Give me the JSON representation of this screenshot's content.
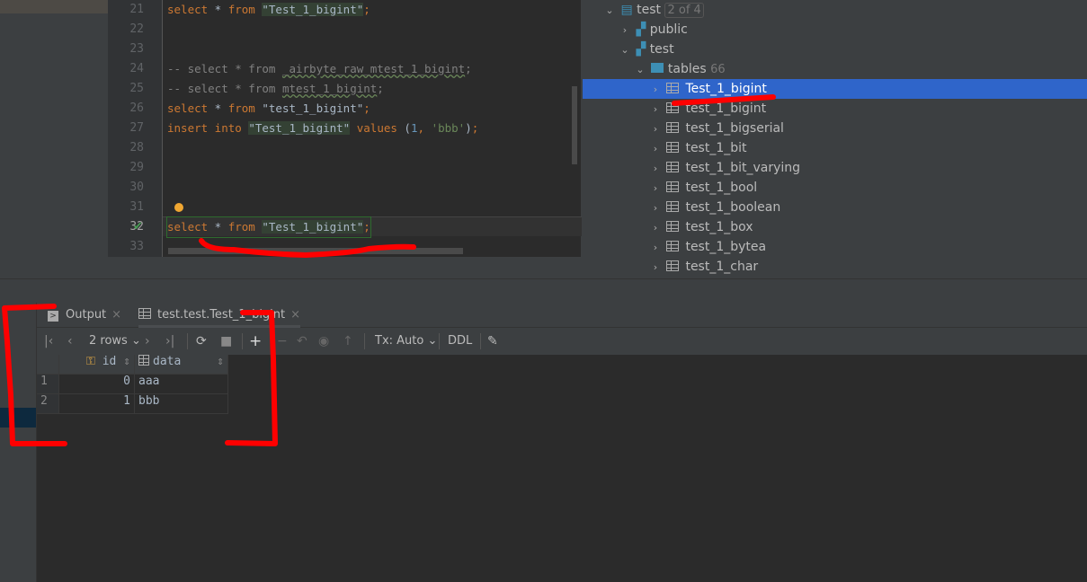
{
  "editor": {
    "lines": [
      {
        "n": "21",
        "tokens": [
          [
            "kw",
            "select"
          ],
          [
            "id",
            " * "
          ],
          [
            "kw",
            "from"
          ],
          [
            "id",
            " "
          ],
          [
            "id hl",
            "\"Test_1_bigint\""
          ],
          [
            "kw",
            ";"
          ]
        ]
      },
      {
        "n": "22",
        "tokens": []
      },
      {
        "n": "23",
        "tokens": []
      },
      {
        "n": "24",
        "tokens": [
          [
            "cm",
            "-- select * from "
          ],
          [
            "cm wavy",
            "_airbyte_raw_mtest_1_bigint"
          ],
          [
            "cm",
            ";"
          ]
        ]
      },
      {
        "n": "25",
        "tokens": [
          [
            "cm",
            "-- select * from "
          ],
          [
            "cm wavy",
            "mtest_1_bigint"
          ],
          [
            "cm",
            ";"
          ]
        ]
      },
      {
        "n": "26",
        "tokens": [
          [
            "kw",
            "select"
          ],
          [
            "id",
            " * "
          ],
          [
            "kw",
            "from"
          ],
          [
            "id",
            " \"test_1_bigint\""
          ],
          [
            "kw",
            ";"
          ]
        ]
      },
      {
        "n": "27",
        "tokens": [
          [
            "kw",
            "insert into"
          ],
          [
            "id",
            " "
          ],
          [
            "id hl",
            "\"Test_1_bigint\""
          ],
          [
            "id",
            " "
          ],
          [
            "kw",
            "values"
          ],
          [
            "id",
            " ("
          ],
          [
            "num",
            "1"
          ],
          [
            "kw",
            ", "
          ],
          [
            "str",
            "'bbb'"
          ],
          [
            "id",
            ")"
          ],
          [
            "kw",
            ";"
          ]
        ]
      },
      {
        "n": "28",
        "tokens": []
      },
      {
        "n": "29",
        "tokens": []
      },
      {
        "n": "30",
        "tokens": []
      },
      {
        "n": "31",
        "tokens": []
      },
      {
        "n": "32",
        "tokens": [
          [
            "kw",
            "select"
          ],
          [
            "id",
            " * "
          ],
          [
            "kw",
            "from"
          ],
          [
            "id",
            " "
          ],
          [
            "id hl",
            "\"Test_1_bigint\""
          ],
          [
            "kw",
            ";"
          ]
        ]
      },
      {
        "n": "33",
        "tokens": []
      }
    ]
  },
  "tree": {
    "root": {
      "label": "test",
      "badge": "2 of 4"
    },
    "schemas": [
      {
        "label": "public"
      },
      {
        "label": "test"
      }
    ],
    "folder": {
      "label": "tables",
      "count": "66"
    },
    "tables": [
      "Test_1_bigint",
      "test_1_bigint",
      "test_1_bigserial",
      "test_1_bit",
      "test_1_bit_varying",
      "test_1_bool",
      "test_1_boolean",
      "test_1_box",
      "test_1_bytea",
      "test_1_char"
    ]
  },
  "results": {
    "tabs": [
      {
        "label": "Output"
      },
      {
        "label": "test.test.Test_1_bigint"
      }
    ],
    "toolbar": {
      "rows": "2 rows",
      "tx": "Tx: Auto",
      "ddl": "DDL"
    },
    "columns": [
      "id",
      "data"
    ],
    "rows": [
      [
        "1",
        "0",
        "aaa"
      ],
      [
        "2",
        "1",
        "bbb"
      ]
    ]
  },
  "colors": {
    "selection": "#2f65ca",
    "keyword": "#cc7832",
    "annotation": "#ff0000"
  }
}
